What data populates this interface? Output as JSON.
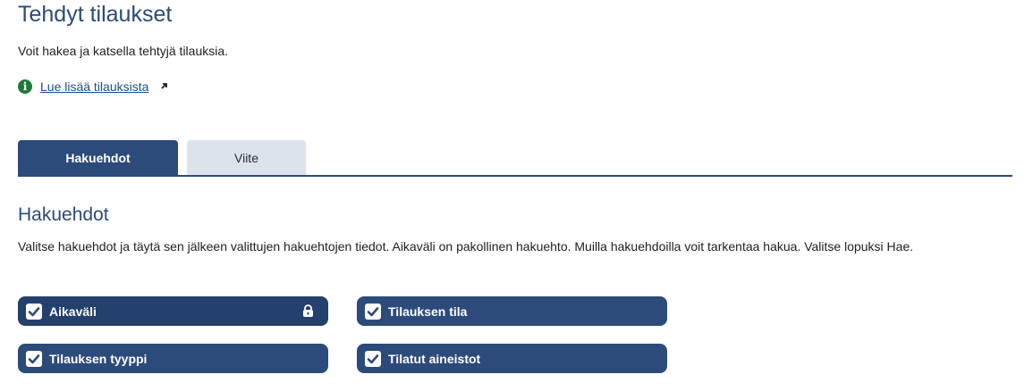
{
  "page": {
    "title": "Tehdyt tilaukset",
    "intro": "Voit hakea ja katsella tehtyjä tilauksia.",
    "info_link": "Lue lisää tilauksista"
  },
  "tabs": [
    {
      "label": "Hakuehdot",
      "active": true
    },
    {
      "label": "Viite",
      "active": false
    }
  ],
  "section": {
    "title": "Hakuehdot",
    "description": "Valitse hakuehdot ja täytä sen jälkeen valittujen hakuehtojen tiedot. Aikaväli on pakollinen hakuehto. Muilla hakuehdoilla voit tarkentaa hakua. Valitse lopuksi Hae."
  },
  "criteria": [
    {
      "label": "Aikaväli",
      "checked": true,
      "locked": true
    },
    {
      "label": "Tilauksen tila",
      "checked": true,
      "locked": false
    },
    {
      "label": "Tilauksen tyyppi",
      "checked": true,
      "locked": false
    },
    {
      "label": "Tilatut aineistot",
      "checked": true,
      "locked": false
    }
  ],
  "icons": {
    "info": "info-icon",
    "external": "external-link-icon",
    "check": "checkbox-checked-icon",
    "lock": "lock-icon"
  },
  "colors": {
    "primary": "#2c4a7a",
    "tab_inactive": "#dde3eb",
    "info_green": "#1e7a3c",
    "link": "#1e4f8c"
  }
}
